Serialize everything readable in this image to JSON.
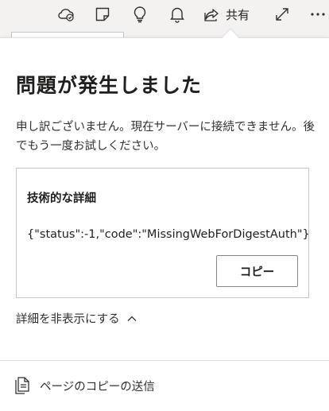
{
  "toolbar": {
    "items": [
      {
        "icon": "cloud-sync-icon"
      },
      {
        "icon": "sticky-note-icon"
      },
      {
        "icon": "lightbulb-icon"
      },
      {
        "icon": "bell-icon"
      },
      {
        "icon": "share-icon",
        "label": "共有"
      },
      {
        "icon": "expand-icon"
      },
      {
        "icon": "more-icon"
      }
    ]
  },
  "error_panel": {
    "title": "問題が発生しました",
    "message": "申し訳ございません。現在サーバーに接続できません。後でもう一度お試しください。",
    "details_heading": "技術的な詳細",
    "details_code": "{\"status\":-1,\"code\":\"MissingWebForDigestAuth\"}",
    "copy_label": "コピー",
    "toggle_label": "詳細を非表示にする",
    "toggle_icon": "chevron-up-icon",
    "send_copy_label": "ページのコピーの送信",
    "send_copy_icon": "send-copy-icon"
  },
  "colors": {
    "toolbar_bg": "#f3f2f1",
    "panel_bg": "#ffffff",
    "text": "#201f1e",
    "border": "#c8c6c4"
  }
}
